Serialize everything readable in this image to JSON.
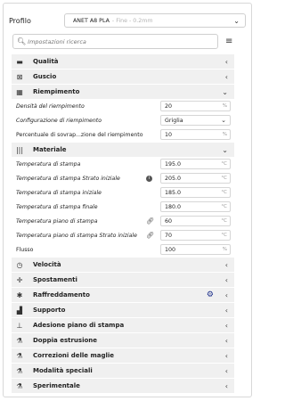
{
  "profile": {
    "label": "Profilo",
    "name": "ANET A8 PLA",
    "detail": "- Fine - 0.2mm"
  },
  "search": {
    "placeholder": "Impostazioni ricerca"
  },
  "categories_top": [
    {
      "name": "quality",
      "icon": "quality-icon",
      "glyph": "▬",
      "label": "Qualità",
      "arrow": "‹"
    },
    {
      "name": "shell",
      "icon": "shell-icon",
      "glyph": "⊠",
      "label": "Guscio",
      "arrow": "‹"
    }
  ],
  "infill": {
    "label": "Riempimento",
    "icon": "infill-icon",
    "glyph": "▦",
    "arrow": "⌄",
    "settings": [
      {
        "label": "Densità del riempimento",
        "value": "20",
        "unit": "%"
      },
      {
        "label": "Configurazione di riempimento",
        "value": "Griglia"
      },
      {
        "label": "Percentuale di sovrap...zione del riempimento",
        "value": "10",
        "unit": "%"
      }
    ]
  },
  "material": {
    "label": "Materiale",
    "icon": "material-icon",
    "glyph": "|||",
    "arrow": "⌄",
    "settings": [
      {
        "label": "Temperatura di stampa",
        "value": "195.0",
        "unit": "°C"
      },
      {
        "label": "Temperatura di stampa Strato iniziale",
        "value": "205.0",
        "unit": "°C",
        "side": "dot"
      },
      {
        "label": "Temperatura di stampa iniziale",
        "value": "185.0",
        "unit": "°C"
      },
      {
        "label": "Temperatura di stampa finale",
        "value": "180.0",
        "unit": "°C"
      },
      {
        "label": "Temperatura piano di stampa",
        "value": "60",
        "unit": "°C",
        "side": "link"
      },
      {
        "label": "Temperatura piano di stampa Strato iniziale",
        "value": "70",
        "unit": "°C",
        "side": "link"
      },
      {
        "label": "Flusso",
        "value": "100",
        "unit": "%"
      }
    ]
  },
  "categories_bottom": [
    {
      "name": "speed",
      "icon": "speed-icon",
      "glyph": "◷",
      "label": "Velocità",
      "arrow": "‹"
    },
    {
      "name": "travel",
      "icon": "travel-icon",
      "glyph": "✛",
      "label": "Spostamenti",
      "arrow": "‹"
    },
    {
      "name": "cooling",
      "icon": "cooling-icon",
      "glyph": "✱",
      "label": "Raffreddamento",
      "arrow": "‹",
      "gear": true
    },
    {
      "name": "support",
      "icon": "support-icon",
      "glyph": "▟",
      "label": "Supporto",
      "arrow": "‹"
    },
    {
      "name": "adhesion",
      "icon": "adhesion-icon",
      "glyph": "⊥",
      "label": "Adesione piano di stampa",
      "arrow": "‹"
    },
    {
      "name": "dual-extrusion",
      "icon": "dual-extrusion-icon",
      "glyph": "⚗",
      "label": "Doppia estrusione",
      "arrow": "‹"
    },
    {
      "name": "mesh-fixes",
      "icon": "mesh-fixes-icon",
      "glyph": "⚗",
      "label": "Correzioni delle maglie",
      "arrow": "‹"
    },
    {
      "name": "special-modes",
      "icon": "special-modes-icon",
      "glyph": "⚗",
      "label": "Modalità speciali",
      "arrow": "‹"
    },
    {
      "name": "experimental",
      "icon": "experimental-icon",
      "glyph": "⚗",
      "label": "Sperimentale",
      "arrow": "‹"
    }
  ]
}
